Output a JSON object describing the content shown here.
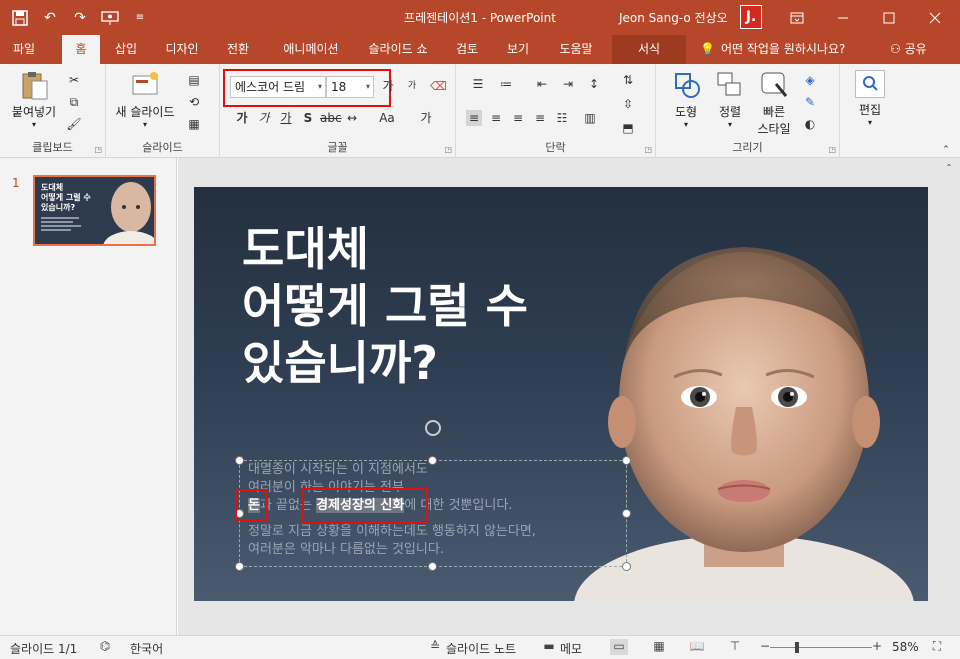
{
  "app": {
    "title": "프레젠테이션1  -  PowerPoint",
    "user_name": "Jeon Sang-o 전상오",
    "user_initial": "J.",
    "brand_color": "#b7472a"
  },
  "qat": [
    "save-icon",
    "undo-icon",
    "redo-icon",
    "present-icon",
    "customize-icon"
  ],
  "tabs": [
    "파일",
    "홈",
    "삽입",
    "디자인",
    "전환",
    "애니메이션",
    "슬라이드 쇼",
    "검토",
    "보기",
    "도움말",
    "서식"
  ],
  "tell_me": "어떤 작업을 원하시나요?",
  "share": "공유",
  "ribbon": {
    "clipboard": {
      "paste": "붙여넣기",
      "label": "클립보드"
    },
    "slides": {
      "new_slide": "새 슬라이드",
      "label": "슬라이드"
    },
    "font": {
      "family": "에스코어 드림",
      "size": "18",
      "label": "글꼴",
      "btn_aa": "Aa",
      "btn_ga": "가"
    },
    "paragraph": {
      "label": "단락"
    },
    "drawing": {
      "shapes": "도형",
      "arrange": "정렬",
      "quick_styles_1": "빠른",
      "quick_styles_2": "스타일",
      "label": "그리기"
    },
    "editing": {
      "label": "편집"
    }
  },
  "thumbnail": {
    "number": "1",
    "lines": [
      "도대체",
      "어떻게 그럴 수",
      "있습니까?"
    ]
  },
  "slide": {
    "headline": [
      "도대체",
      "어떻게 그럴 수",
      "있습니까?"
    ],
    "body": {
      "line1": "대멸종이 시작되는 이 지점에서도",
      "line2": "여러분이 하는 이야기는 전부",
      "line3_a": "돈",
      "line3_b": "과 끝없는 ",
      "line3_sel": "경제성장의 신화",
      "line3_c": "에 대한 것뿐입니다.",
      "line4": "정말로 지금 상황을 이해하는데도 행동하지 않는다면,",
      "line5": "여러분은 악마나 다름없는 것입니다."
    }
  },
  "status": {
    "slide_count": "슬라이드 1/1",
    "language": "한국어",
    "notes": "슬라이드 노트",
    "comments": "메모",
    "zoom": "58%"
  }
}
